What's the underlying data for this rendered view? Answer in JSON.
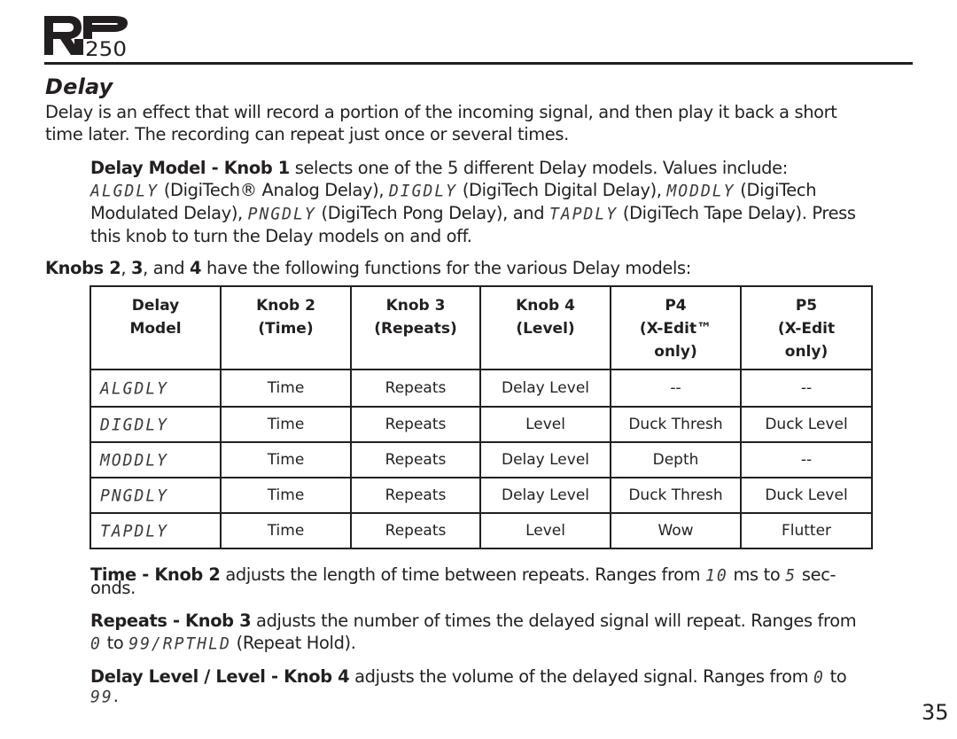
{
  "header": {
    "logo_letters": "RP",
    "logo_model": "250"
  },
  "section_title": "Delay",
  "intro": {
    "line1": "Delay is an effect that will record a portion of the incoming signal, and then play it back a short",
    "line2": "time later.  The recording can repeat just once or several times."
  },
  "delay_model": {
    "heading": "Delay Model - Knob 1",
    "l1_rest": " selects one of the 5 different Delay models. Values include:",
    "models": [
      {
        "code": "ALGDLY",
        "desc": " (DigiTech® Analog Delay), "
      },
      {
        "code": "DIGDLY",
        "desc": " (DigiTech Digital Delay), "
      },
      {
        "code": "MODDLY",
        "desc": " (DigiTech"
      },
      {
        "code": "PNGDLY",
        "desc": " (DigiTech Pong Delay), and "
      },
      {
        "code": "TAPDLY",
        "desc": " (DigiTech Tape Delay). Press"
      }
    ],
    "l3_start": "Modulated Delay), ",
    "l4": "this knob to turn the Delay models on and off."
  },
  "knobs_intro": {
    "b1": "Knobs 2",
    "t1": ", ",
    "b2": "3",
    "t2": ", and ",
    "b3": "4",
    "t3": " have the following functions for the various Delay models:"
  },
  "table": {
    "headers": [
      [
        "Delay",
        "Model",
        ""
      ],
      [
        "Knob 2",
        "(Time)",
        ""
      ],
      [
        "Knob 3",
        "(Repeats)",
        ""
      ],
      [
        "Knob 4",
        "(Level)",
        ""
      ],
      [
        "P4",
        "(X-Edit™",
        "only)"
      ],
      [
        "P5",
        "(X-Edit",
        "only)"
      ]
    ],
    "rows": [
      [
        "ALGDLY",
        "Time",
        "Repeats",
        "Delay Level",
        "--",
        "--"
      ],
      [
        "DIGDLY",
        "Time",
        "Repeats",
        "Level",
        "Duck Thresh",
        "Duck Level"
      ],
      [
        "MODDLY",
        "Time",
        "Repeats",
        "Delay Level",
        "Depth",
        "--"
      ],
      [
        "PNGDLY",
        "Time",
        "Repeats",
        "Delay Level",
        "Duck Thresh",
        "Duck Level"
      ],
      [
        "TAPDLY",
        "Time",
        "Repeats",
        "Level",
        "Wow",
        "Flutter"
      ]
    ]
  },
  "time_desc": {
    "heading": "Time - Knob 2",
    "text1": " adjusts the length of time between repeats. Ranges from ",
    "min": "10",
    "text2": " ms to ",
    "max": "5",
    "text3": " sec-",
    "wrap": "onds."
  },
  "repeats_desc": {
    "heading": "Repeats - Knob 3",
    "text1": " adjusts the number of times the delayed signal will repeat. Ranges from",
    "min": "0",
    "text2": " to ",
    "max": "99/RPTHLD",
    "text3": " (Repeat Hold)."
  },
  "level_desc": {
    "heading": "Delay Level / Level - Knob 4",
    "text1": " adjusts the volume of the delayed signal. Ranges from ",
    "min": "0",
    "text2": " to",
    "max": "99",
    "text3": "."
  },
  "page_number": "35"
}
